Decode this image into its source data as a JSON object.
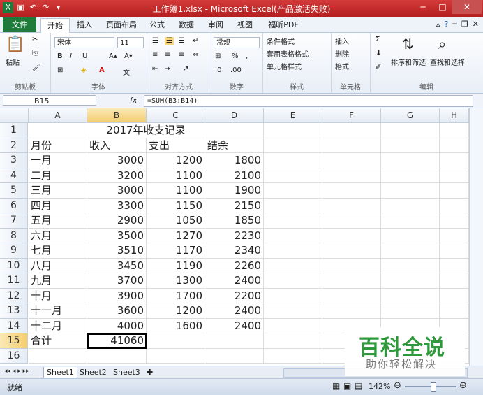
{
  "window": {
    "title": "工作簿1.xlsx - Microsoft Excel(产品激活失败)"
  },
  "tabs": [
    "文件",
    "开始",
    "插入",
    "页面布局",
    "公式",
    "数据",
    "审阅",
    "视图",
    "福昕PDF"
  ],
  "ribbon": {
    "clipboard": {
      "label": "剪贴板",
      "paste": "粘贴"
    },
    "font": {
      "label": "字体",
      "name": "宋体",
      "size": "11",
      "bold": "B",
      "italic": "I",
      "underline": "U"
    },
    "alignment": {
      "label": "对齐方式"
    },
    "number": {
      "label": "数字",
      "format": "常规"
    },
    "styles": {
      "label": "样式",
      "conditional": "条件格式",
      "table": "套用表格格式",
      "cell": "单元格样式"
    },
    "cells": {
      "label": "单元格",
      "insert": "插入",
      "delete": "删除",
      "format": "格式"
    },
    "editing": {
      "label": "编辑",
      "sort": "排序和筛选",
      "find": "查找和选择"
    }
  },
  "formula_bar": {
    "name_box": "B15",
    "fx": "fx",
    "formula": "=SUM(B3:B14)"
  },
  "columns": [
    "A",
    "B",
    "C",
    "D",
    "E",
    "F",
    "G",
    "H"
  ],
  "rows": [
    {
      "n": "1",
      "a": "",
      "b": "2017年收支记录",
      "c": "",
      "d": ""
    },
    {
      "n": "2",
      "a": "月份",
      "b": "收入",
      "c": "支出",
      "d": "结余"
    },
    {
      "n": "3",
      "a": "一月",
      "b": "3000",
      "c": "1200",
      "d": "1800"
    },
    {
      "n": "4",
      "a": "二月",
      "b": "3200",
      "c": "1100",
      "d": "2100"
    },
    {
      "n": "5",
      "a": "三月",
      "b": "3000",
      "c": "1100",
      "d": "1900"
    },
    {
      "n": "6",
      "a": "四月",
      "b": "3300",
      "c": "1150",
      "d": "2150"
    },
    {
      "n": "7",
      "a": "五月",
      "b": "2900",
      "c": "1050",
      "d": "1850"
    },
    {
      "n": "8",
      "a": "六月",
      "b": "3500",
      "c": "1270",
      "d": "2230"
    },
    {
      "n": "9",
      "a": "七月",
      "b": "3510",
      "c": "1170",
      "d": "2340"
    },
    {
      "n": "10",
      "a": "八月",
      "b": "3450",
      "c": "1190",
      "d": "2260"
    },
    {
      "n": "11",
      "a": "九月",
      "b": "3700",
      "c": "1300",
      "d": "2400"
    },
    {
      "n": "12",
      "a": "十月",
      "b": "3900",
      "c": "1700",
      "d": "2200"
    },
    {
      "n": "13",
      "a": "十一月",
      "b": "3600",
      "c": "1200",
      "d": "2400"
    },
    {
      "n": "14",
      "a": "十二月",
      "b": "4000",
      "c": "1600",
      "d": "2400"
    },
    {
      "n": "15",
      "a": "合计",
      "b": "41060",
      "c": "",
      "d": ""
    },
    {
      "n": "16",
      "a": "",
      "b": "",
      "c": "",
      "d": ""
    }
  ],
  "sheets": [
    "Sheet1",
    "Sheet2",
    "Sheet3"
  ],
  "status": {
    "ready": "就绪",
    "zoom": "142%"
  },
  "watermark": {
    "big": "百科全说",
    "small": "助你轻松解决"
  }
}
